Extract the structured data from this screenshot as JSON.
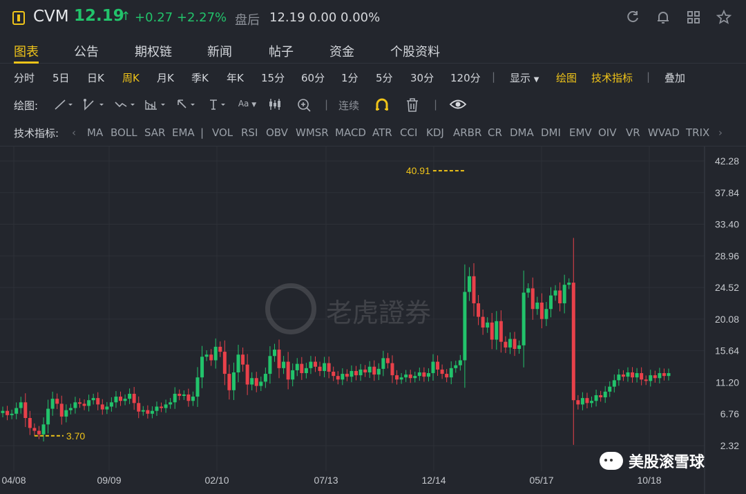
{
  "quote": {
    "symbol": "CVM",
    "price": "12.19",
    "arrow": "↑",
    "change": "+0.27 +2.27%",
    "after_hours_label": "盘后",
    "after_hours": "12.19 0.00 0.00%"
  },
  "header_icons": [
    "refresh-icon",
    "bell-icon",
    "grid-icon",
    "star-icon"
  ],
  "tabs": [
    "图表",
    "公告",
    "期权链",
    "新闻",
    "帖子",
    "资金",
    "个股资料"
  ],
  "periods": [
    "分时",
    "5日",
    "日K",
    "周K",
    "月K",
    "季K",
    "年K",
    "15分",
    "60分",
    "1分",
    "5分",
    "30分",
    "120分"
  ],
  "period_active": "周K",
  "display_label": "显示",
  "draw_label": "绘图",
  "tech_label": "技术指标",
  "overlay_label": "叠加",
  "tools": {
    "label": "绘图:",
    "font_label": "Aa",
    "continuous": "连续"
  },
  "indicators": {
    "label": "技术指标:",
    "items": [
      "MA",
      "BOLL",
      "SAR",
      "EMA",
      "|",
      "VOL",
      "RSI",
      "OBV",
      "WMSR",
      "MACD",
      "ATR",
      "CCI",
      "KDJ",
      "ARBR",
      "CR",
      "DMA",
      "DMI",
      "EMV",
      "OIV",
      "VR",
      "WVAD",
      "TRIX"
    ]
  },
  "watermark": "老虎證券",
  "brand": "美股滚雪球",
  "colors": {
    "up": "#22c36b",
    "down": "#e8414a",
    "accent": "#f0c419",
    "bg": "#23262d"
  },
  "chart_data": {
    "type": "candlestick",
    "y_ticks": [
      "42.28",
      "37.84",
      "33.40",
      "28.96",
      "24.52",
      "20.08",
      "15.64",
      "11.20",
      "6.76",
      "2.32"
    ],
    "ylim": [
      2.32,
      42.28
    ],
    "x_ticks": [
      "04/08",
      "09/09",
      "02/10",
      "07/13",
      "12/14",
      "05/17",
      "10/18"
    ],
    "high_marker": "40.91",
    "low_marker": "3.70",
    "closes": [
      7.2,
      6.6,
      6.8,
      7.6,
      8.4,
      6.2,
      4.8,
      4.4,
      3.9,
      5.3,
      7.5,
      8.9,
      8.2,
      6.4,
      7.3,
      7.6,
      8.4,
      8.2,
      7.9,
      8.7,
      9.0,
      8.1,
      7.4,
      7.8,
      8.4,
      9.2,
      8.6,
      8.9,
      9.6,
      8.3,
      7.1,
      7.3,
      6.8,
      7.2,
      7.8,
      7.6,
      8.1,
      8.4,
      9.6,
      9.3,
      9.5,
      8.6,
      9.2,
      11.9,
      14.8,
      15.1,
      14.3,
      16.2,
      15.5,
      12.4,
      10.1,
      12.6,
      15.1,
      13.7,
      10.9,
      11.8,
      10.7,
      11.3,
      12.4,
      14.9,
      15.8,
      13.2,
      14.1,
      11.6,
      12.9,
      13.8,
      12.5,
      13.2,
      14.1,
      13.4,
      12.8,
      13.9,
      12.7,
      12.1,
      11.6,
      12.4,
      12.0,
      12.8,
      12.2,
      13.0,
      12.6,
      13.4,
      12.3,
      13.1,
      14.6,
      13.9,
      12.2,
      11.6,
      11.9,
      12.3,
      11.8,
      12.1,
      12.6,
      12.0,
      12.5,
      14.1,
      13.0,
      12.4,
      11.9,
      13.2,
      13.6,
      14.3,
      23.9,
      26.1,
      22.3,
      20.4,
      18.9,
      19.6,
      17.2,
      19.8,
      16.9,
      16.1,
      17.3,
      15.9,
      16.4,
      23.8,
      24.4,
      21.5,
      22.4,
      20.1,
      21.5,
      23.4,
      24.1,
      22.3,
      24.9,
      25.2,
      8.7,
      8.1,
      9.0,
      8.3,
      8.6,
      9.4,
      9.1,
      9.9,
      10.6,
      11.5,
      12.3,
      12.0,
      12.6,
      11.9,
      12.5,
      11.6,
      11.4,
      12.2,
      11.8,
      12.5,
      12.1,
      12.5
    ]
  }
}
